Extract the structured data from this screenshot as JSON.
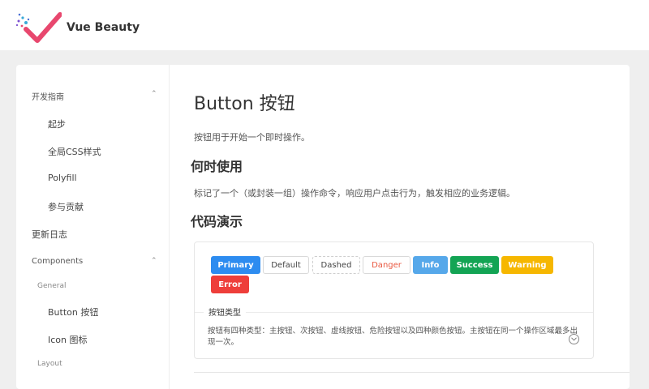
{
  "header": {
    "brand": "Vue Beauty"
  },
  "sidebar": {
    "items": [
      {
        "label": "开发指南",
        "level": "group-title",
        "expanded": true
      },
      {
        "label": "起步",
        "level": "l2"
      },
      {
        "label": "全局CSS样式",
        "level": "l2"
      },
      {
        "label": "Polyfill",
        "level": "l2"
      },
      {
        "label": "参与贡献",
        "level": "l2"
      },
      {
        "label": "更新日志",
        "level": "l1"
      },
      {
        "label": "Components",
        "level": "group-title",
        "expanded": true
      },
      {
        "label": "General",
        "level": "subgroup"
      },
      {
        "label": "Button 按钮",
        "level": "l2"
      },
      {
        "label": "Icon 图标",
        "level": "l2"
      },
      {
        "label": "Layout",
        "level": "subgroup"
      }
    ]
  },
  "main": {
    "title": "Button 按钮",
    "intro": "按钮用于开始一个即时操作。",
    "when_heading": "何时使用",
    "when_text": "标记了一个（或封装一组）操作命令，响应用户点击行为，触发相应的业务逻辑。",
    "demo_heading": "代码演示",
    "demo": {
      "buttons": [
        {
          "label": "Primary",
          "type": "primary"
        },
        {
          "label": "Default",
          "type": "default"
        },
        {
          "label": "Dashed",
          "type": "dashed"
        },
        {
          "label": "Danger",
          "type": "danger"
        },
        {
          "label": "Info",
          "type": "info"
        },
        {
          "label": "Success",
          "type": "success"
        },
        {
          "label": "Warning",
          "type": "warning"
        },
        {
          "label": "Error",
          "type": "error"
        }
      ],
      "meta_title": "按钮类型",
      "meta_desc": "按钮有四种类型：主按钮、次按钮、虚线按钮、危险按钮以及四种颜色按钮。主按钮在同一个操作区域最多出现一次。"
    }
  },
  "colors": {
    "primary": "#2d8cf0",
    "info": "#56a8ea",
    "success": "#13a454",
    "warning": "#f6b700",
    "error": "#ee3e3a",
    "danger_text": "#e9573f",
    "logo_red": "#e8476e"
  }
}
